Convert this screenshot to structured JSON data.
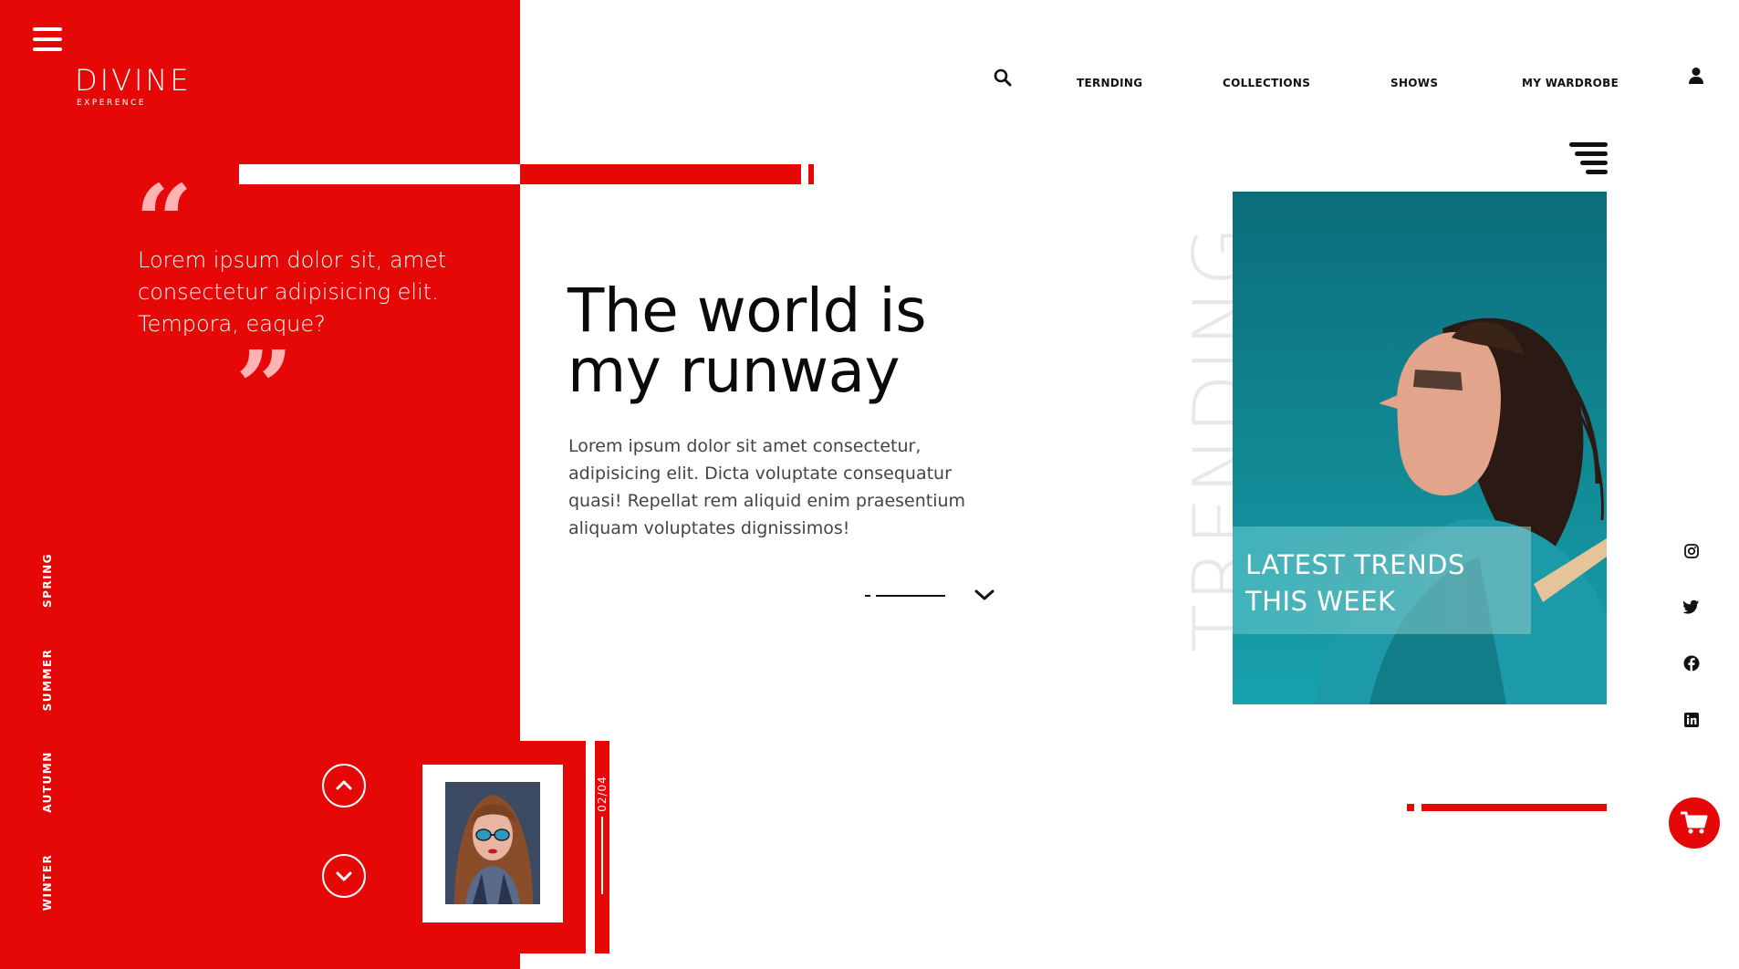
{
  "brand": {
    "name": "DIVINE",
    "tagline": "EXPERENCE"
  },
  "nav": {
    "items": [
      "TERNDING",
      "COLLECTIONS",
      "SHOWS",
      "MY WARDROBE"
    ]
  },
  "quote": {
    "text": "Lorem ipsum dolor sit, amet consectetur adipisicing elit. Tempora, eaque?",
    "open_mark": "“",
    "close_mark": "”"
  },
  "seasons": [
    "SPRING",
    "SUMMER",
    "AUTUMN",
    "WINTER"
  ],
  "hero": {
    "title_line1": "The world is",
    "title_line2": "my runway",
    "body": "Lorem ipsum dolor sit amet consectetur, adipisicing elit. Dicta voluptate consequatur quasi! Repellat rem aliquid enim praesentium aliquam voluptates dignissimos!"
  },
  "slider": {
    "counter": "02/04"
  },
  "trending": {
    "vertical_label": "TRENDING",
    "caption_line1": "LATEST TRENDS",
    "caption_line2": "THIS WEEK"
  },
  "icons": {
    "menu": "hamburger-menu-icon",
    "search": "search-icon",
    "user": "user-icon",
    "filter": "filter-lines-icon",
    "up": "chevron-up-icon",
    "down": "chevron-down-icon",
    "scroll": "chevron-down-icon",
    "cart": "cart-icon",
    "social": [
      "instagram-icon",
      "twitter-icon",
      "facebook-icon",
      "linkedin-icon"
    ]
  },
  "colors": {
    "accent": "#e60707",
    "text": "#111111",
    "muted_text": "#444444",
    "trending_watermark": "#e8e8e8",
    "card_bg": "#0f7f8a"
  }
}
